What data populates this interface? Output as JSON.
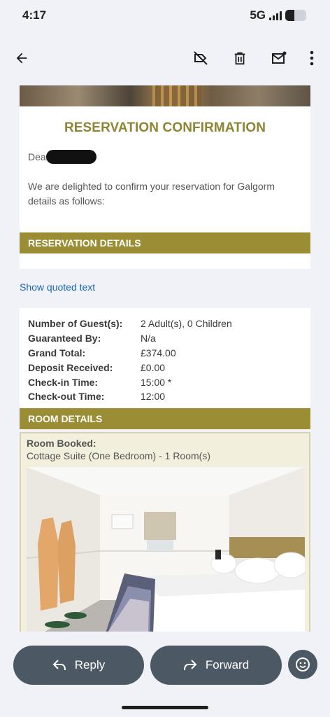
{
  "status": {
    "time": "4:17",
    "network": "5G",
    "signal_bars": 4,
    "battery_level": 0.45
  },
  "app_bar": {
    "icons": [
      "back-arrow-icon",
      "label-off-icon",
      "delete-icon",
      "mark-unread-icon",
      "more-vert-icon"
    ]
  },
  "email": {
    "title": "RESERVATION CONFIRMATION",
    "greeting": "Dear",
    "intro": "We are delighted to confirm your reservation for Galgorm details as follows:",
    "section_reservation": "RESERVATION DETAILS",
    "show_quoted": "Show quoted text",
    "details": [
      {
        "label": "Number of Guest(s):",
        "value": "2 Adult(s), 0 Children"
      },
      {
        "label": "Guaranteed By:",
        "value": "N/a"
      },
      {
        "label": "Grand Total:",
        "value": "£374.00"
      },
      {
        "label": "Deposit Received:",
        "value": "£0.00"
      },
      {
        "label": "Check-in Time:",
        "value": "15:00 *"
      },
      {
        "label": "Check-out Time:",
        "value": "12:00"
      }
    ],
    "section_room": "ROOM DETAILS",
    "room_booked_label": "Room Booked:",
    "room_booked_value": "Cottage Suite (One Bedroom) - 1 Room(s)"
  },
  "actions": {
    "reply": "Reply",
    "forward": "Forward",
    "emoji_icon": "emoji-reaction-icon"
  },
  "colors": {
    "accent_gold": "#9a8d34",
    "title_gold": "#8d8434",
    "link": "#1a66b3",
    "pill": "#4c5965"
  }
}
